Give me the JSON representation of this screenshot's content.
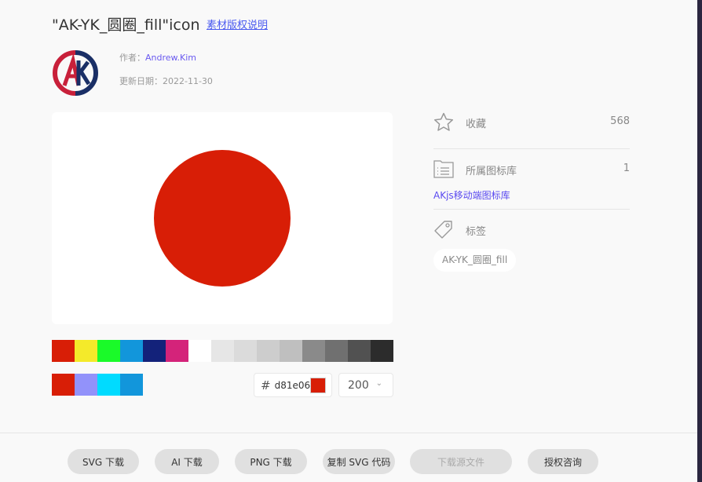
{
  "header": {
    "title": "\"AK-YK_圆圈_fill\"icon",
    "license_link": "素材版权说明"
  },
  "meta": {
    "author_label": "作者：",
    "author": "Andrew.Kim",
    "date_label": "更新日期：",
    "date": "2022-11-30"
  },
  "preview": {
    "icon_color": "#d81e06"
  },
  "palette": {
    "row1": [
      "#d81e06",
      "#f4ea2a",
      "#1afa29",
      "#1296db",
      "#13227a",
      "#d4237a",
      "#ffffff",
      "#e6e6e6",
      "#dbdbdb",
      "#cdcdcd",
      "#bfbfbf",
      "#8a8a8a",
      "#707070",
      "#515151",
      "#2c2c2c"
    ],
    "row2": [
      "#d81e06",
      "#9292fa",
      "#00dbff",
      "#1296db"
    ]
  },
  "color_input": {
    "hash": "#",
    "value": "d81e06"
  },
  "size_select": {
    "value": "200"
  },
  "sidebar": {
    "favorites_label": "收藏",
    "favorites_count": "568",
    "library_label": "所属图标库",
    "library_count": "1",
    "library_link": "AKjs移动端图标库",
    "tags_label": "标签",
    "tag": "AK-YK_圆圈_fill"
  },
  "footer": {
    "buttons": [
      "SVG 下载",
      "AI 下载",
      "PNG 下载",
      "复制 SVG 代码",
      "下载源文件",
      "授权咨询"
    ]
  }
}
